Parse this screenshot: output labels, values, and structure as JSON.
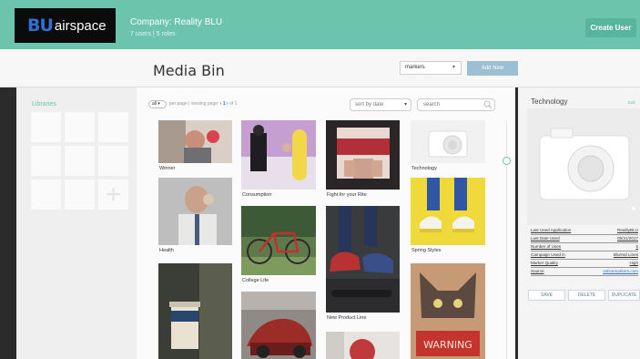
{
  "brand": {
    "mark": "BU",
    "text": "airspace"
  },
  "company": {
    "name": "Company: Reality BLU",
    "sub": "7 users | 5 roles"
  },
  "topbar": {
    "create_user": "Create User"
  },
  "header": {
    "title": "Media Bin",
    "filter_value": "markers",
    "add_new": "Add New"
  },
  "libraries": {
    "label": "Libraries"
  },
  "toolbar": {
    "perpage_value": "all",
    "perpage_prefix": "per page  |  viewing page: ",
    "page_current": "‹ 1 ›",
    "page_suffix": " of 1",
    "sort_value": "sort by date",
    "search_placeholder": "search"
  },
  "media": [
    {
      "caption": "Winner"
    },
    {
      "caption": "Health"
    },
    {
      "caption": ""
    },
    {
      "caption": "Consumption"
    },
    {
      "caption": "College Life"
    },
    {
      "caption": ""
    },
    {
      "caption": "Fight for your Rite"
    },
    {
      "caption": "New Product Line"
    },
    {
      "caption": ""
    },
    {
      "caption": "Technology"
    },
    {
      "caption": "Spring Styles"
    },
    {
      "caption": ""
    }
  ],
  "detail": {
    "title": "Technology",
    "edit": "Edit",
    "meta": [
      {
        "key": "Last Used Application",
        "value": "RealityBLU"
      },
      {
        "key": "Last Date Used",
        "value": "05/31/2017"
      },
      {
        "key": "Number of Uses",
        "value": "5"
      },
      {
        "key": "Campaign Used in",
        "value": "Blurred Lines"
      },
      {
        "key": "Marker Quality",
        "value": "High"
      },
      {
        "key": "Source",
        "value": "onlinemarkers.com"
      }
    ],
    "actions": {
      "save": "SAVE",
      "delete": "DELETE",
      "duplicate": "DUPLICATE"
    }
  },
  "colors": {
    "accent": "#6cc4ad",
    "link": "#2f6fd6",
    "button_muted": "#9dbfd3"
  }
}
